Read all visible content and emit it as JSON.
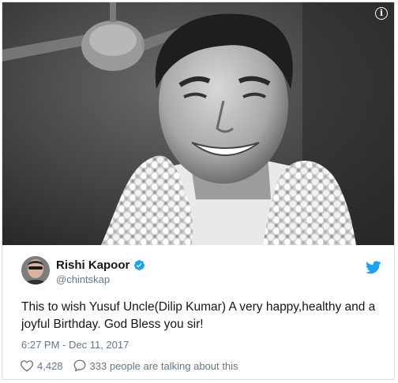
{
  "photo": {
    "alt_subject": "black-and-white portrait photo",
    "info_icon": "info-icon"
  },
  "tweet": {
    "display_name": "Rishi Kapoor",
    "handle": "@chintskap",
    "verified": true,
    "text": "This to wish Yusuf Uncle(Dilip Kumar) A very happy,healthy and a joyful Birthday. God Bless you sir!",
    "timestamp": "6:27 PM - Dec 11, 2017",
    "likes": "4,428",
    "conversation": "333 people are talking about this"
  },
  "icons": {
    "platform": "twitter-bird-icon",
    "verified": "verified-badge-icon",
    "like": "heart-icon",
    "reply": "speech-bubble-icon"
  },
  "colors": {
    "brand_blue": "#1da1f2",
    "text": "#14171a",
    "muted": "#657786",
    "border": "#dcdfe2"
  }
}
